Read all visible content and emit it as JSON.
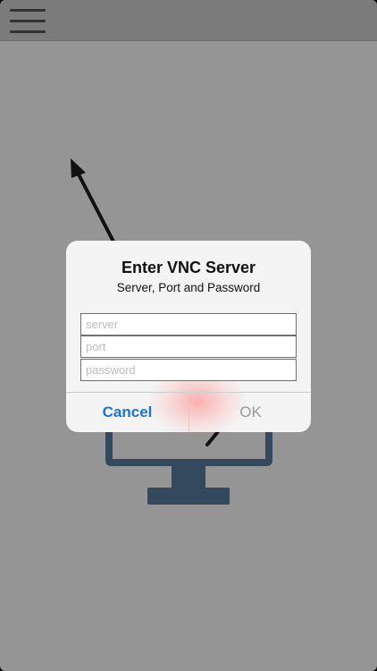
{
  "nav": {
    "menu_icon": "hamburger-menu-icon"
  },
  "illustration": {
    "arrow_icon": "arrow-up-left-icon",
    "monitor_icon": "monitor-icon",
    "colors": {
      "arrow": "#111111",
      "monitor": "#34495e"
    }
  },
  "dialog": {
    "title": "Enter VNC Server",
    "message": "Server, Port and Password",
    "fields": {
      "server": {
        "placeholder": "server",
        "value": ""
      },
      "port": {
        "placeholder": "port",
        "value": ""
      },
      "password": {
        "placeholder": "password",
        "value": ""
      }
    },
    "buttons": {
      "cancel": "Cancel",
      "ok": "OK"
    },
    "colors": {
      "cancel": "#1a73d9",
      "ok_disabled": "#9a9a9a"
    }
  }
}
